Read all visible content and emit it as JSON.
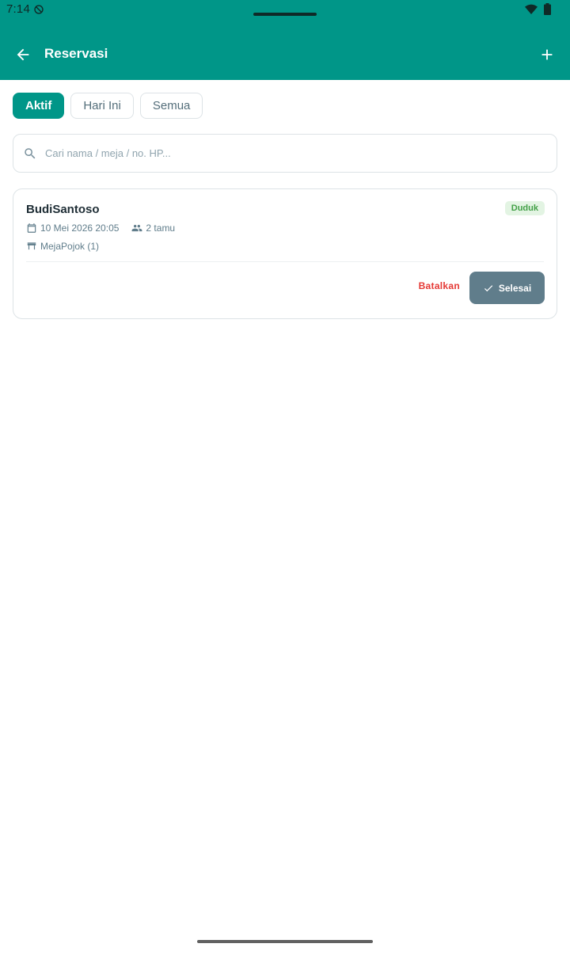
{
  "status_bar": {
    "time": "7:14"
  },
  "app_bar": {
    "title": "Reservasi"
  },
  "filters": [
    {
      "label": "Aktif",
      "active": true
    },
    {
      "label": "Hari Ini",
      "active": false
    },
    {
      "label": "Semua",
      "active": false
    }
  ],
  "search": {
    "placeholder": "Cari nama / meja / no. HP...",
    "value": ""
  },
  "reservations": [
    {
      "name": "BudiSantoso",
      "status": "Duduk",
      "datetime": "10 Mei 2026 20:05",
      "guests": "2 tamu",
      "table": "MejaPojok (1)",
      "cancel_label": "Batalkan",
      "done_label": "Selesai"
    }
  ],
  "colors": {
    "primary": "#009688",
    "status_badge_bg": "#e3f4e3",
    "status_badge_text": "#43a047",
    "cancel": "#e53935",
    "done_button": "#607d8b"
  },
  "icons": [
    "dnd-icon",
    "wifi-icon",
    "battery-icon",
    "back-arrow-icon",
    "add-icon",
    "search-icon",
    "calendar-icon",
    "people-icon",
    "table-icon",
    "check-icon"
  ]
}
